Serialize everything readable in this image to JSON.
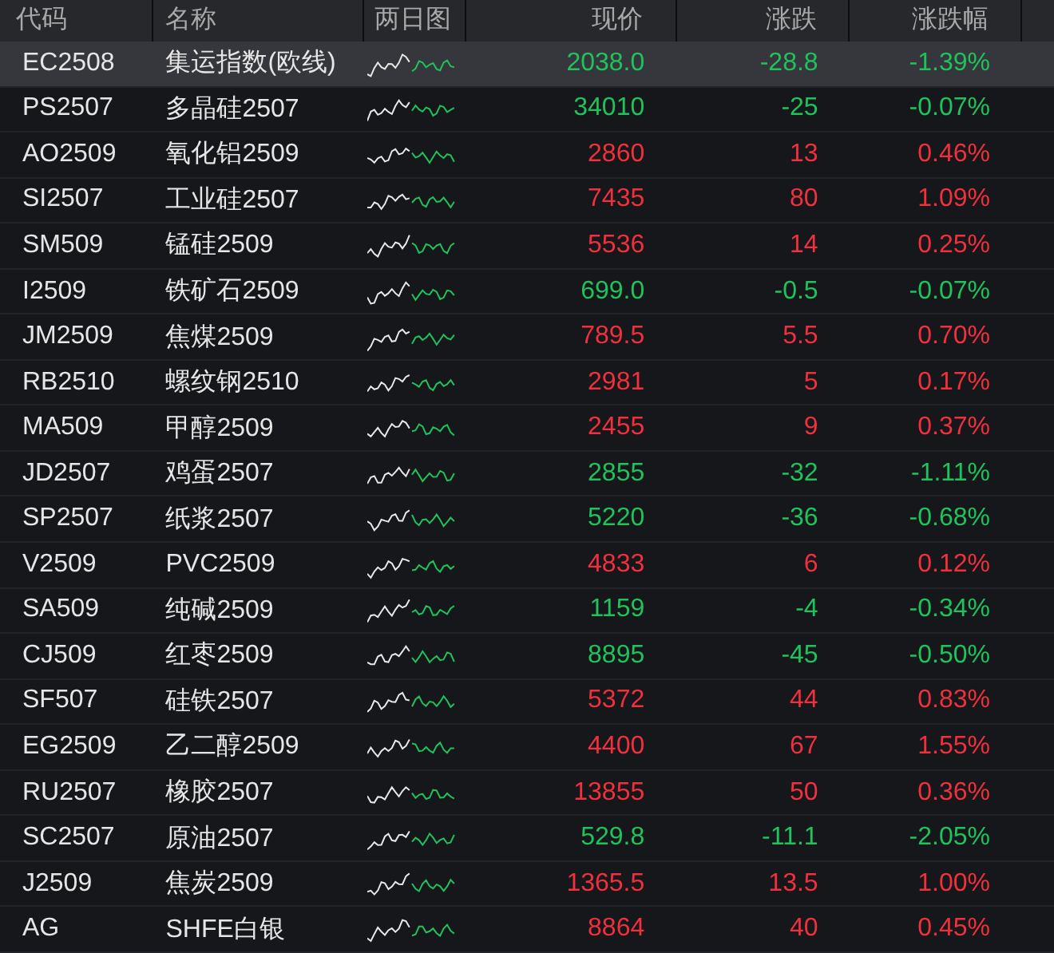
{
  "table": {
    "columns": [
      "代码",
      "名称",
      "两日图",
      "现价",
      "涨跌",
      "涨跌幅"
    ],
    "rows": [
      {
        "code": "EC2508",
        "name": "集运指数(欧线)",
        "price": "2038.0",
        "change": "-28.8",
        "pct": "-1.39%",
        "color": "#20c25c",
        "selected": true
      },
      {
        "code": "PS2507",
        "name": "多晶硅2507",
        "price": "34010",
        "change": "-25",
        "pct": "-0.07%",
        "color": "#20c25c",
        "selected": false
      },
      {
        "code": "AO2509",
        "name": "氧化铝2509",
        "price": "2860",
        "change": "13",
        "pct": "0.46%",
        "color": "#f0303c",
        "selected": false
      },
      {
        "code": "SI2507",
        "name": "工业硅2507",
        "price": "7435",
        "change": "80",
        "pct": "1.09%",
        "color": "#f0303c",
        "selected": false
      },
      {
        "code": "SM509",
        "name": "锰硅2509",
        "price": "5536",
        "change": "14",
        "pct": "0.25%",
        "color": "#f0303c",
        "selected": false
      },
      {
        "code": "I2509",
        "name": "铁矿石2509",
        "price": "699.0",
        "change": "-0.5",
        "pct": "-0.07%",
        "color": "#20c25c",
        "selected": false
      },
      {
        "code": "JM2509",
        "name": "焦煤2509",
        "price": "789.5",
        "change": "5.5",
        "pct": "0.70%",
        "color": "#f0303c",
        "selected": false
      },
      {
        "code": "RB2510",
        "name": "螺纹钢2510",
        "price": "2981",
        "change": "5",
        "pct": "0.17%",
        "color": "#f0303c",
        "selected": false
      },
      {
        "code": "MA509",
        "name": "甲醇2509",
        "price": "2455",
        "change": "9",
        "pct": "0.37%",
        "color": "#f0303c",
        "selected": false
      },
      {
        "code": "JD2507",
        "name": "鸡蛋2507",
        "price": "2855",
        "change": "-32",
        "pct": "-1.11%",
        "color": "#20c25c",
        "selected": false
      },
      {
        "code": "SP2507",
        "name": "纸浆2507",
        "price": "5220",
        "change": "-36",
        "pct": "-0.68%",
        "color": "#20c25c",
        "selected": false
      },
      {
        "code": "V2509",
        "name": "PVC2509",
        "price": "4833",
        "change": "6",
        "pct": "0.12%",
        "color": "#f0303c",
        "selected": false
      },
      {
        "code": "SA509",
        "name": "纯碱2509",
        "price": "1159",
        "change": "-4",
        "pct": "-0.34%",
        "color": "#20c25c",
        "selected": false
      },
      {
        "code": "CJ509",
        "name": "红枣2509",
        "price": "8895",
        "change": "-45",
        "pct": "-0.50%",
        "color": "#20c25c",
        "selected": false
      },
      {
        "code": "SF507",
        "name": "硅铁2507",
        "price": "5372",
        "change": "44",
        "pct": "0.83%",
        "color": "#f0303c",
        "selected": false
      },
      {
        "code": "EG2509",
        "name": "乙二醇2509",
        "price": "4400",
        "change": "67",
        "pct": "1.55%",
        "color": "#f0303c",
        "selected": false
      },
      {
        "code": "RU2507",
        "name": "橡胶2507",
        "price": "13855",
        "change": "50",
        "pct": "0.36%",
        "color": "#f0303c",
        "selected": false
      },
      {
        "code": "SC2507",
        "name": "原油2507",
        "price": "529.8",
        "change": "-11.1",
        "pct": "-2.05%",
        "color": "#20c25c",
        "selected": false
      },
      {
        "code": "J2509",
        "name": "焦炭2509",
        "price": "1365.5",
        "change": "13.5",
        "pct": "1.00%",
        "color": "#f0303c",
        "selected": false
      },
      {
        "code": "AG",
        "name": "SHFE白银",
        "price": "8864",
        "change": "40",
        "pct": "0.45%",
        "color": "#f0303c",
        "selected": false
      }
    ]
  }
}
